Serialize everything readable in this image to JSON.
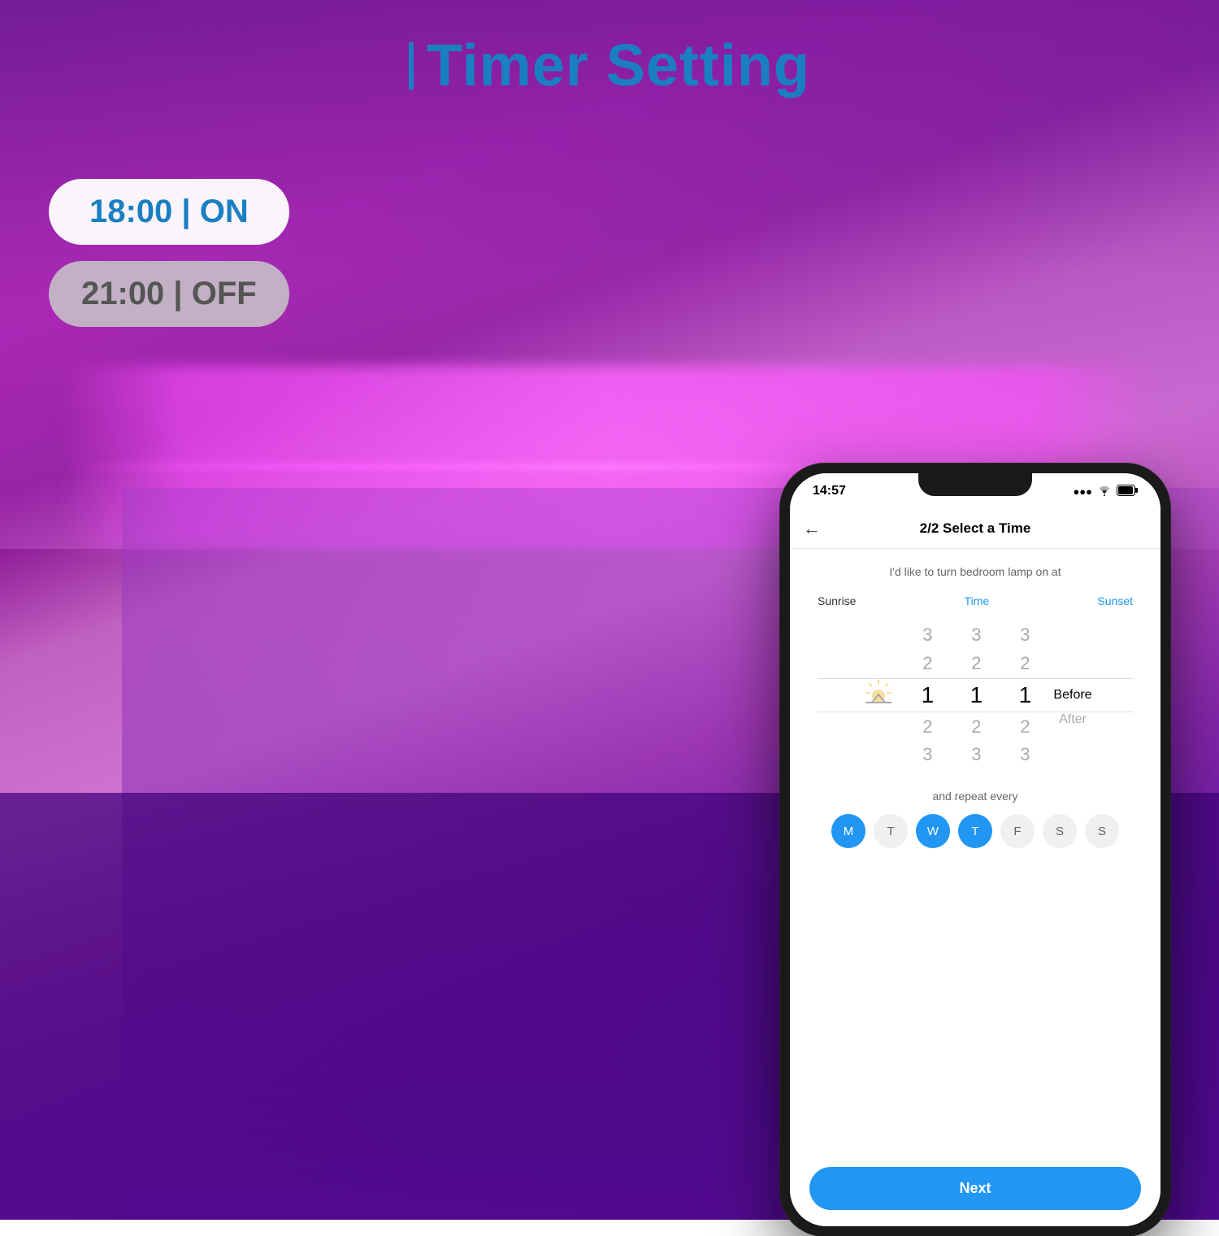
{
  "page": {
    "title": "Timer Setting",
    "title_bar": "|"
  },
  "timers": [
    {
      "label": "18:00 | ON"
    },
    {
      "label": "21:00 | OFF"
    }
  ],
  "phone": {
    "status_bar": {
      "time": "14:57",
      "signal_icon": "▲",
      "wifi_icon": "wifi",
      "battery_icon": "battery"
    },
    "header": {
      "back_label": "←",
      "title": "2/2 Select a Time"
    },
    "subtitle": "I'd like to turn bedroom lamp on at",
    "time_options": {
      "left": "Sunrise",
      "center": "Time",
      "right": "Sunset"
    },
    "picker": {
      "left_col": [
        "3",
        "2",
        "1",
        "2",
        "3"
      ],
      "center_col": [
        "3",
        "2",
        "1",
        "2",
        "3"
      ],
      "right_col": [
        "3",
        "2",
        "1",
        "2",
        "3"
      ],
      "selected_index": 2,
      "before_after": [
        "",
        "",
        "Before",
        "After",
        ""
      ]
    },
    "repeat_label": "and repeat every",
    "days": [
      {
        "label": "M",
        "active": true
      },
      {
        "label": "T",
        "active": false
      },
      {
        "label": "W",
        "active": true
      },
      {
        "label": "T",
        "active": true
      },
      {
        "label": "F",
        "active": false
      },
      {
        "label": "S",
        "active": false
      },
      {
        "label": "S",
        "active": false
      }
    ],
    "next_button": "Next"
  }
}
